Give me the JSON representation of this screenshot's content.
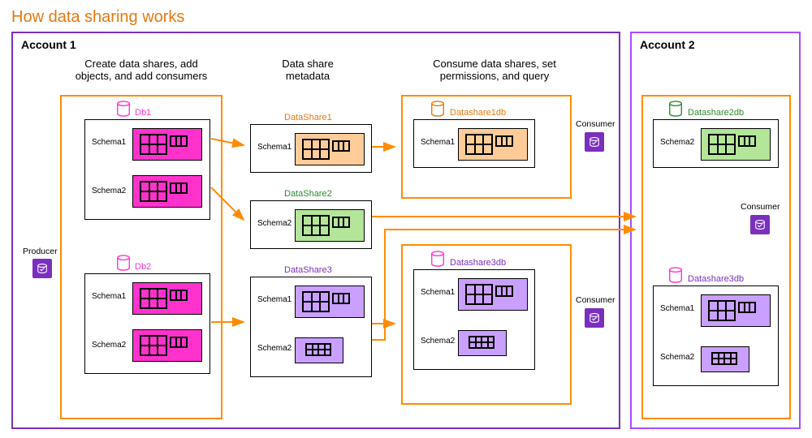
{
  "title": "How data sharing works",
  "accounts": {
    "a1": "Account 1",
    "a2": "Account 2"
  },
  "columns": {
    "producer": "Create data shares, add\nobjects, and add consumers",
    "metadata": "Data share\nmetadata",
    "consumer": "Consume data shares, set\npermissions, and query"
  },
  "labels": {
    "producer": "Producer",
    "consumer": "Consumer",
    "db1": "Db1",
    "db2": "Db2",
    "ds1": "DataShare1",
    "ds2": "DataShare2",
    "ds3": "DataShare3",
    "ds1db": "Datashare1db",
    "ds2db": "Datashare2db",
    "ds3db": "Datashare3db",
    "schema1": "Schema1",
    "schema2": "Schema2"
  },
  "colors": {
    "orange": "#e47911",
    "purple": "#7b2fbf",
    "pink": "#ff33cc",
    "green": "#2e8b2e",
    "arrow": "#ff8c00"
  }
}
